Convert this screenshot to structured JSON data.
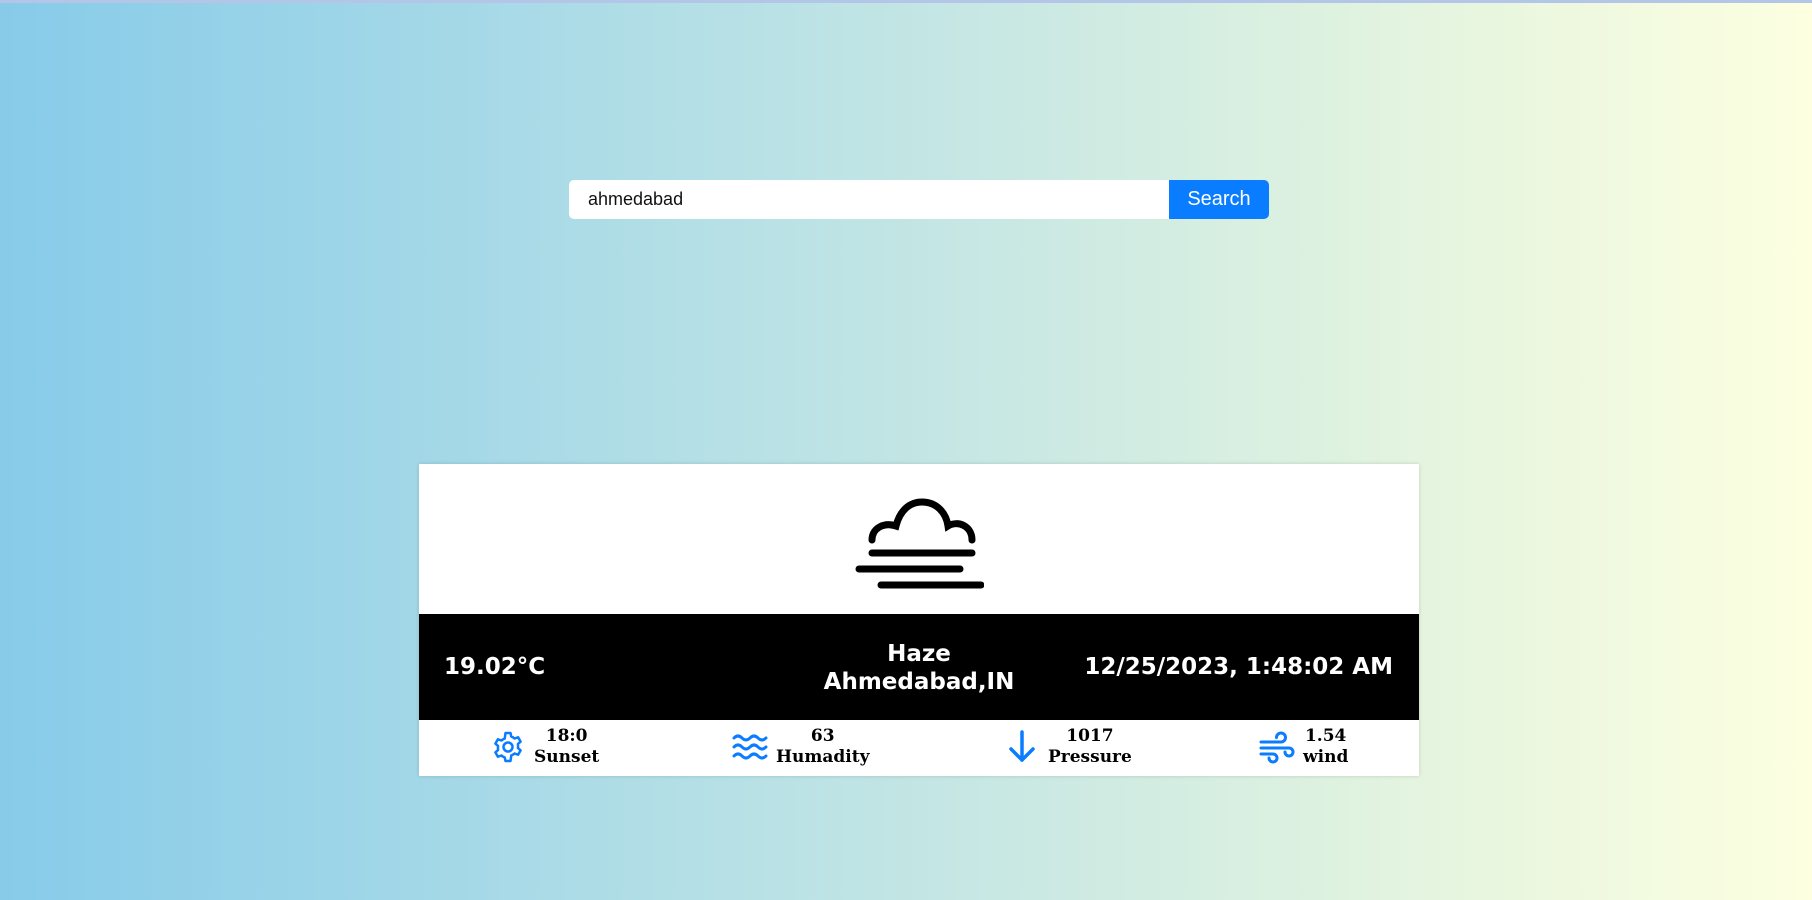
{
  "search": {
    "value": "ahmedabad",
    "button_label": "Search"
  },
  "weather": {
    "icon": "haze-icon",
    "temperature": "19.02°C",
    "condition": "Haze",
    "location": "Ahmedabad,IN",
    "datetime": "12/25/2023, 1:48:02 AM"
  },
  "stats": [
    {
      "icon": "gear-icon",
      "value": "18:0",
      "label": "Sunset"
    },
    {
      "icon": "waves-icon",
      "value": "63",
      "label": "Humadity"
    },
    {
      "icon": "arrow-down-icon",
      "value": "1017",
      "label": "Pressure"
    },
    {
      "icon": "wind-icon",
      "value": "1.54",
      "label": "wind"
    }
  ],
  "colors": {
    "accent": "#0a7cff",
    "info_bar": "#000000",
    "card": "#ffffff"
  }
}
